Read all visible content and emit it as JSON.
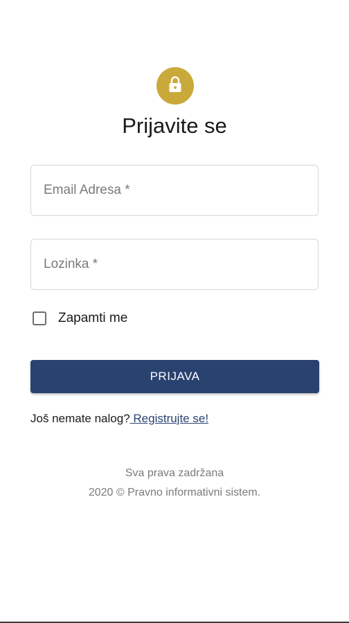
{
  "login": {
    "icon": "lock-icon",
    "accent_color": "#c9a93a",
    "title": "Prijavite se",
    "email_label": "Email Adresa *",
    "password_label": "Lozinka *",
    "remember_label": "Zapamti me",
    "remember_checked": false,
    "submit_label": "PRIJAVA",
    "submit_color": "#2a4270",
    "no_account_text": "Još nemate nalog?",
    "register_link": " Registrujte se!"
  },
  "footer": {
    "rights": "Sva prava zadržana",
    "copyright": "2020 © Pravno informativni sistem."
  }
}
